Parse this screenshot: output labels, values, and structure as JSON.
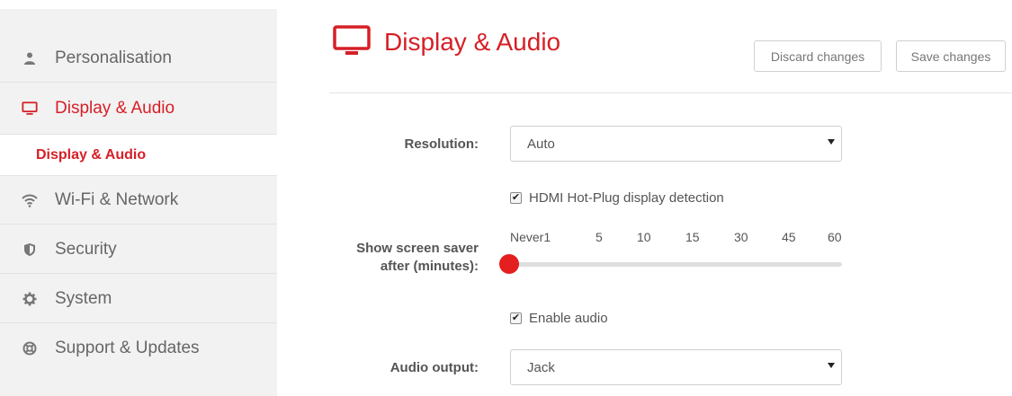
{
  "sidebar": {
    "items": [
      {
        "label": "Personalisation",
        "icon": "user-icon"
      },
      {
        "label": "Display & Audio",
        "icon": "monitor-icon",
        "active": true
      },
      {
        "label": "Wi-Fi & Network",
        "icon": "wifi-icon"
      },
      {
        "label": "Security",
        "icon": "shield-icon"
      },
      {
        "label": "System",
        "icon": "gear-icon"
      },
      {
        "label": "Support & Updates",
        "icon": "lifebuoy-icon"
      }
    ],
    "sub_item": {
      "label": "Display & Audio"
    }
  },
  "header": {
    "title": "Display & Audio",
    "icon": "monitor-icon",
    "discard_label": "Discard changes",
    "save_label": "Save changes"
  },
  "form": {
    "resolution": {
      "label": "Resolution:",
      "value": "Auto"
    },
    "hdmi_detection": {
      "label": "HDMI Hot-Plug display detection",
      "checked": true
    },
    "screen_saver": {
      "label_line1": "Show screen saver",
      "label_line2": "after (minutes):",
      "ticks": [
        "Never1",
        "5",
        "10",
        "15",
        "30",
        "45",
        "60"
      ],
      "selected_index": 0
    },
    "enable_audio": {
      "label": "Enable audio",
      "checked": true
    },
    "audio_output": {
      "label": "Audio output:",
      "value": "Jack"
    }
  },
  "colors": {
    "accent": "#d61f26",
    "sidebar_bg": "#f2f2f2",
    "slider_thumb": "#e41f1f"
  }
}
